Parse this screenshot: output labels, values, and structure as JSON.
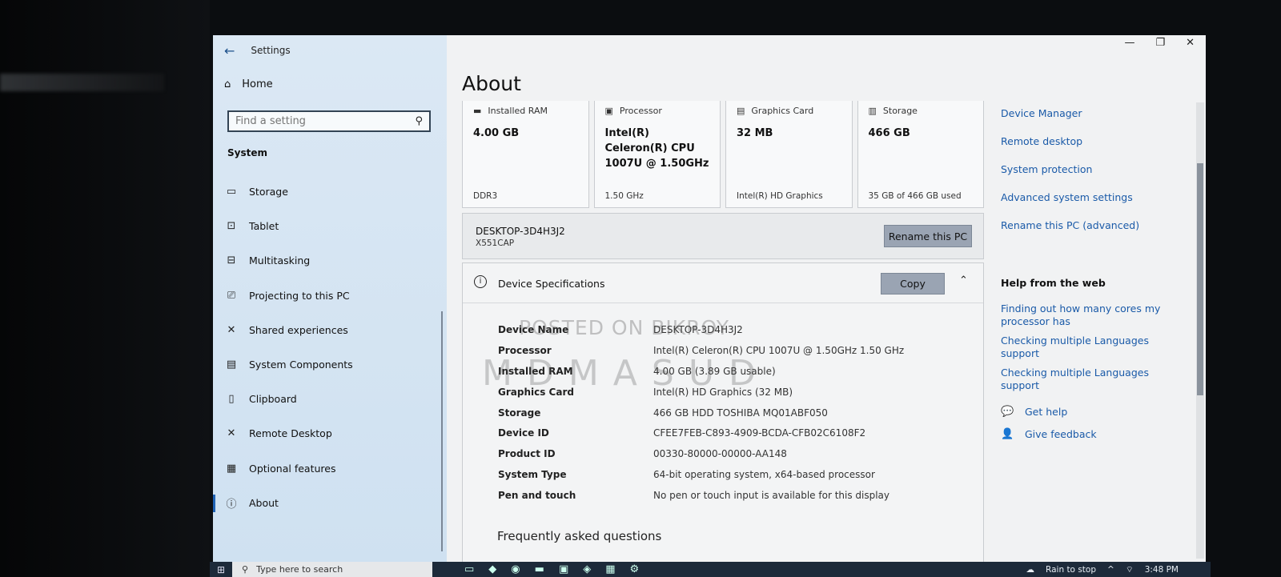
{
  "window": {
    "app_title": "Settings",
    "controls": {
      "minimize": "—",
      "restore": "❐",
      "close": "✕"
    }
  },
  "sidebar": {
    "back": "←",
    "home_label": "Home",
    "search": {
      "placeholder": "Find a setting",
      "value": ""
    },
    "section_label": "System",
    "items": [
      {
        "label": "Storage",
        "icon": "▭"
      },
      {
        "label": "Tablet",
        "icon": "⊡"
      },
      {
        "label": "Multitasking",
        "icon": "⊟"
      },
      {
        "label": "Projecting to this PC",
        "icon": "⎚"
      },
      {
        "label": "Shared experiences",
        "icon": "✕"
      },
      {
        "label": "System Components",
        "icon": "▤"
      },
      {
        "label": "Clipboard",
        "icon": "▯"
      },
      {
        "label": "Remote Desktop",
        "icon": "✕"
      },
      {
        "label": "Optional features",
        "icon": "▦"
      },
      {
        "label": "About",
        "icon": "ⓘ"
      }
    ]
  },
  "main": {
    "page_title": "About",
    "cards": [
      {
        "label": "Installed RAM",
        "value": "4.00 GB",
        "sub": "DDR3"
      },
      {
        "label": "Processor",
        "value": "Intel(R) Celeron(R) CPU 1007U @ 1.50GHz",
        "sub": "1.50 GHz"
      },
      {
        "label": "Graphics Card",
        "value": "32 MB",
        "sub": "Intel(R) HD Graphics"
      },
      {
        "label": "Storage",
        "value": "466 GB",
        "sub": "35 GB of 466 GB used"
      }
    ],
    "pc": {
      "name": "DESKTOP-3D4H3J2",
      "model": "X551CAP",
      "rename_label": "Rename this PC"
    },
    "specs": {
      "title": "Device Specifications",
      "copy_label": "Copy",
      "rows": [
        {
          "key": "Device Name",
          "value": "DESKTOP-3D4H3J2"
        },
        {
          "key": "Processor",
          "value": "Intel(R) Celeron(R) CPU 1007U @ 1.50GHz   1.50 GHz"
        },
        {
          "key": "Installed RAM",
          "value": "4.00 GB (3.89 GB usable)"
        },
        {
          "key": "Graphics Card",
          "value": "Intel(R) HD Graphics (32 MB)"
        },
        {
          "key": "Storage",
          "value": "466 GB HDD TOSHIBA MQ01ABF050"
        },
        {
          "key": "Device ID",
          "value": "CFEE7FEB-C893-4909-BCDA-CFB02C6108F2"
        },
        {
          "key": "Product ID",
          "value": "00330-80000-00000-AA148"
        },
        {
          "key": "System Type",
          "value": "64-bit operating system, x64-based processor"
        },
        {
          "key": "Pen and touch",
          "value": "No pen or touch input is available for this display"
        }
      ],
      "faq": "Frequently asked questions",
      "watermark_line1": "POSTED ON BIKROY",
      "watermark_line2": "MDMASUD"
    }
  },
  "related": {
    "links": [
      "Device Manager",
      "Remote desktop",
      "System protection",
      "Advanced system settings",
      "Rename this PC (advanced)"
    ],
    "help_title": "Help from the web",
    "help_links": [
      "Finding out how many cores my processor has",
      "Checking multiple Languages support",
      "Checking multiple Languages support"
    ],
    "support": [
      {
        "label": "Get help",
        "icon": "💬"
      },
      {
        "label": "Give feedback",
        "icon": "👤"
      }
    ]
  },
  "taskbar": {
    "search_placeholder": "Type here to search",
    "weather": "Rain to stop",
    "time": "3:48 PM"
  }
}
